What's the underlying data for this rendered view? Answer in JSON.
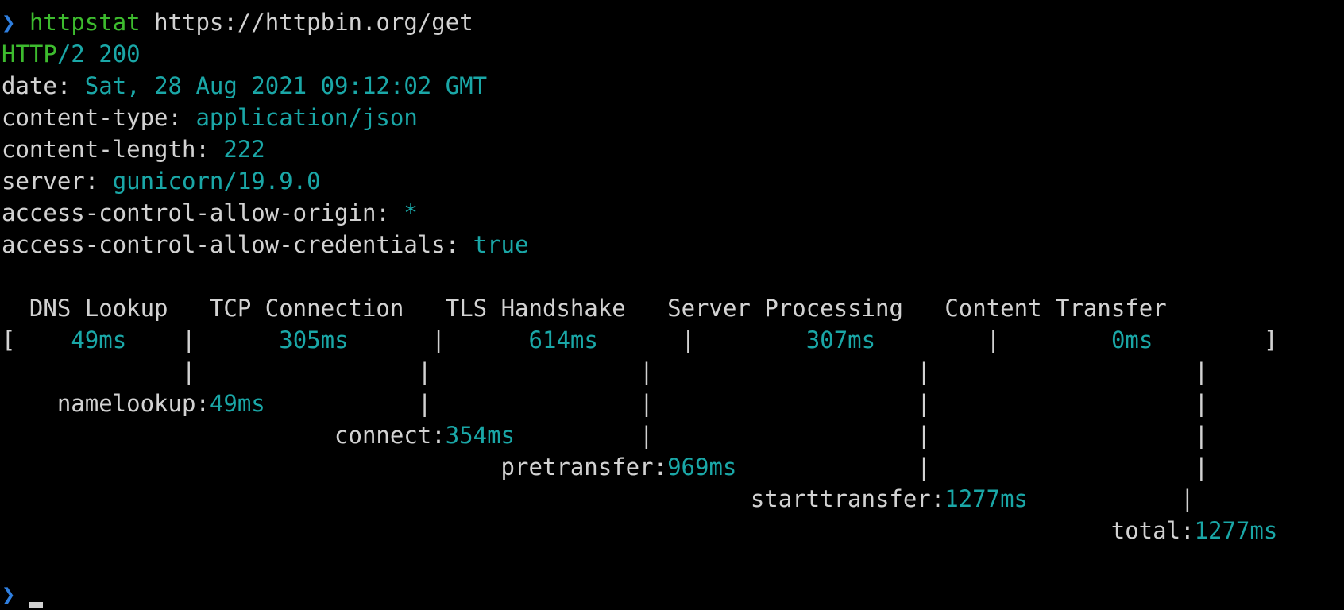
{
  "terminal": {
    "command": {
      "prompt": "❯",
      "name": "httpstat",
      "url": "https://httpbin.org/get"
    },
    "status": {
      "protocol": "HTTP",
      "version": "/2 200"
    },
    "headers": [
      {
        "key": "date:",
        "value": "Sat, 28 Aug 2021 09:12:02 GMT"
      },
      {
        "key": "content-type:",
        "value": "application/json"
      },
      {
        "key": "content-length:",
        "value": "222"
      },
      {
        "key": "server:",
        "value": "gunicorn/19.9.0"
      },
      {
        "key": "access-control-allow-origin:",
        "value": "*"
      },
      {
        "key": "access-control-allow-credentials:",
        "value": "true"
      }
    ],
    "timing": {
      "phases": [
        "DNS Lookup",
        "TCP Connection",
        "TLS Handshake",
        "Server Processing",
        "Content Transfer"
      ],
      "durations": [
        "49ms",
        "305ms",
        "614ms",
        "307ms",
        "0ms"
      ],
      "bracket_open": "[",
      "bracket_close": "]",
      "separator": "|",
      "cumulative": [
        {
          "label": "namelookup:",
          "value": "49ms"
        },
        {
          "label": "connect:",
          "value": "354ms"
        },
        {
          "label": "pretransfer:",
          "value": "969ms"
        },
        {
          "label": "starttransfer:",
          "value": "1277ms"
        },
        {
          "label": "total:",
          "value": "1277ms"
        }
      ]
    },
    "next_prompt": "❯"
  },
  "colors": {
    "background": "#000000",
    "prompt": "#2f7fe0",
    "command": "#3dbb2e",
    "value": "#1aa7a7",
    "text": "#d2d2d2"
  }
}
